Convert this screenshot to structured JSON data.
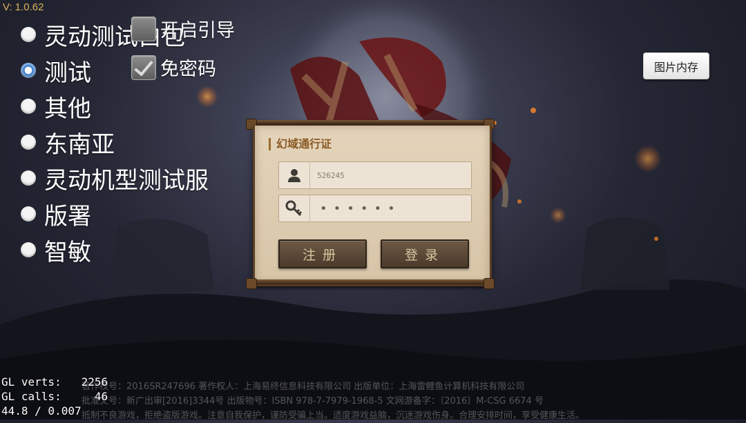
{
  "version": "V: 1.0.62",
  "servers": [
    {
      "label": "灵动测试白包",
      "selected": false
    },
    {
      "label": "测试",
      "selected": true
    },
    {
      "label": "其他",
      "selected": false
    },
    {
      "label": "东南亚",
      "selected": false
    },
    {
      "label": "灵动机型测试服",
      "selected": false
    },
    {
      "label": "版署",
      "selected": false
    },
    {
      "label": "智敏",
      "selected": false
    }
  ],
  "options": {
    "guide": {
      "label": "开启引导",
      "checked": false
    },
    "no_password": {
      "label": "免密码",
      "checked": true
    }
  },
  "cache_button": "图片内存",
  "login": {
    "title": "幻域通行证",
    "username": "526245",
    "password_mask": "••••••",
    "register_label": "注册",
    "login_label": "登录"
  },
  "stats": {
    "gl_verts": "GL verts:   2256",
    "gl_calls": "GL calls:     46",
    "fps": "44.8 / 0.007"
  },
  "legal": [
    "著作权号：2016SR247696  著作权人：上海易终信息科技有限公司  出版单位：上海雷鲤鱼计算机科技有限公司",
    "批准文号：新广出审[2016]3344号  出版物号：ISBN 978-7-7979-1968-5  文网游备字：〔2016〕M-CSG 6674 号",
    "抵制不良游戏，拒绝盗版游戏。注意自我保护，谨防受骗上当。适度游戏益脑，沉迷游戏伤身。合理安排时间，享受健康生活。"
  ]
}
